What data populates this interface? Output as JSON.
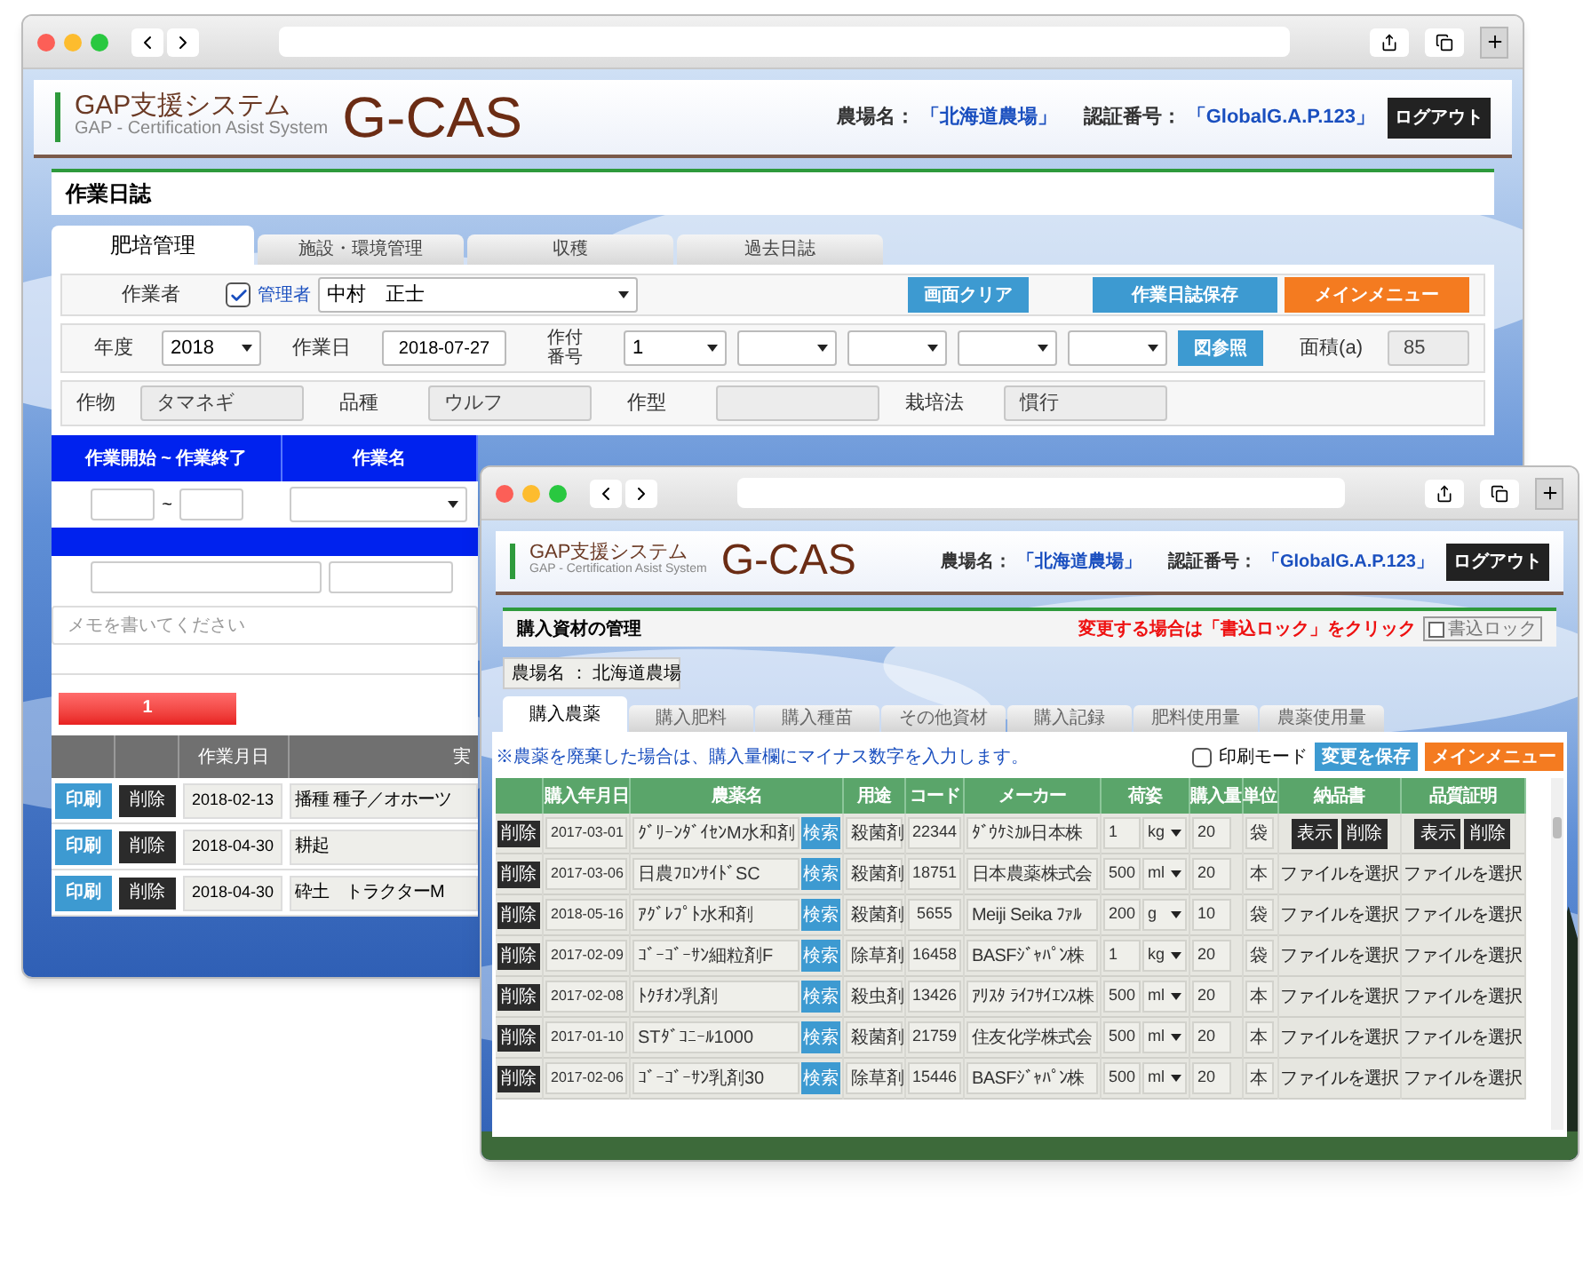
{
  "back_window": {
    "header": {
      "system_name": "GAP支援システム",
      "subtitle": "GAP - Certification Asist System",
      "logo": "G-CAS",
      "farm_label": "農場名：",
      "farm": "「北海道農場」",
      "cert_label": "認証番号：",
      "cert": "「GlobalG.A.P.123」",
      "logout": "ログアウト"
    },
    "page_title": "作業日誌",
    "tabs": [
      {
        "label": "肥培管理",
        "selected": true
      },
      {
        "label": "施設・環境管理",
        "selected": false
      },
      {
        "label": "収穫",
        "selected": false
      },
      {
        "label": "過去日誌",
        "selected": false
      }
    ],
    "worker_row": {
      "label": "作業者",
      "admin": {
        "label": "管理者",
        "checked": true
      },
      "worker": "中村　正士",
      "buttons": [
        {
          "label": "画面クリア",
          "kind": "blue"
        },
        {
          "label": "作業日誌保存",
          "kind": "blue"
        },
        {
          "label": "メインメニュー",
          "kind": "orange"
        }
      ]
    },
    "date_row": {
      "year_label": "年度",
      "year": "2018",
      "date_label": "作業日",
      "date": "2018-07-27",
      "plot_label": "作付番号",
      "plot_number": "1",
      "map_button": "図参照",
      "area_label": "面積(a)",
      "area": "85"
    },
    "crop_row": [
      {
        "label": "作物",
        "value": "タマネギ"
      },
      {
        "label": "品種",
        "value": "ウルフ"
      },
      {
        "label": "作型"
      },
      {
        "label": "栽培法",
        "value": "慣行"
      }
    ],
    "work_table": {
      "columns": [
        "作業開始 ~ 作業終了",
        "作業名"
      ],
      "range_separator": "~"
    },
    "memo": {
      "placeholder": "メモを書いてください"
    },
    "pager": [
      {
        "label": "1",
        "selected": true
      }
    ],
    "history": {
      "columns": [
        "作業月日",
        "実"
      ],
      "rows": [
        {
          "print": "印刷",
          "delete": "削除",
          "date": "2018-02-13",
          "content": "播種 種子／オホーツ"
        },
        {
          "print": "印刷",
          "delete": "削除",
          "date": "2018-04-30",
          "content": "耕起"
        },
        {
          "print": "印刷",
          "delete": "削除",
          "date": "2018-04-30",
          "content": "砕土　トラクターM"
        }
      ]
    }
  },
  "front_window": {
    "header": {
      "system_name": "GAP支援システム",
      "subtitle": "GAP - Certification Asist System",
      "logo": "G-CAS",
      "farm_label": "農場名：",
      "farm": "「北海道農場」",
      "cert_label": "認証番号：",
      "cert": "「GlobalG.A.P.123」",
      "logout": "ログアウト"
    },
    "page_title": "購入資材の管理",
    "lock_notice": "変更する場合は「書込ロック」をクリック",
    "lock": {
      "label": "書込ロック",
      "checked": false
    },
    "farm_field": "農場名 ： 北海道農場",
    "tabs": [
      {
        "label": "購入農薬",
        "selected": true
      },
      {
        "label": "購入肥料",
        "selected": false
      },
      {
        "label": "購入種苗",
        "selected": false
      },
      {
        "label": "その他資材",
        "selected": false
      },
      {
        "label": "購入記録",
        "selected": false
      },
      {
        "label": "肥料使用量",
        "selected": false
      },
      {
        "label": "農薬使用量",
        "selected": false
      }
    ],
    "note": "※農薬を廃棄した場合は、購入量欄にマイナス数字を入力します。",
    "print_mode": {
      "label": "印刷モード",
      "checked": false
    },
    "buttons": [
      {
        "label": "変更を保存",
        "kind": "blue"
      },
      {
        "label": "メインメニュー",
        "kind": "orange"
      }
    ],
    "table": {
      "columns": [
        "購入年月日",
        "農薬名",
        "用途",
        "コード",
        "メーカー",
        "荷姿",
        "購入量",
        "単位",
        "納品書",
        "品質証明"
      ],
      "rows": [
        {
          "delete": "削除",
          "date": "2017-03-01",
          "name": "ｸﾞﾘｰﾝﾀﾞｲｾﾝM水和剤",
          "search": "検索",
          "use": "殺菌剤",
          "code": "22344",
          "maker": "ﾀﾞｳｹﾐｶﾙ日本株",
          "amount": "1",
          "pack_unit": "kg",
          "quantity": "20",
          "unit": "袋",
          "delivery": {
            "kind": "uploaded",
            "buttons": [
              "表示",
              "削除"
            ]
          },
          "certificate": {
            "kind": "uploaded",
            "buttons": [
              "表示",
              "削除"
            ]
          }
        },
        {
          "delete": "削除",
          "date": "2017-03-06",
          "name": "日農ﾌﾛﾝｻｲﾄﾞSC",
          "search": "検索",
          "use": "殺菌剤",
          "code": "18751",
          "maker": "日本農薬株式会",
          "amount": "500",
          "pack_unit": "ml",
          "quantity": "20",
          "unit": "本",
          "delivery": {
            "kind": "file",
            "label": "ファイルを選択"
          },
          "certificate": {
            "kind": "file",
            "label": "ファイルを選択"
          }
        },
        {
          "delete": "削除",
          "date": "2018-05-16",
          "name": "ｱｸﾞﾚﾌﾟﾄ水和剤",
          "search": "検索",
          "use": "殺菌剤",
          "code": "5655",
          "maker": "Meiji Seika ﾌｧﾙ",
          "amount": "200",
          "pack_unit": "g",
          "quantity": "10",
          "unit": "袋",
          "delivery": {
            "kind": "file",
            "label": "ファイルを選択"
          },
          "certificate": {
            "kind": "file",
            "label": "ファイルを選択"
          }
        },
        {
          "delete": "削除",
          "date": "2017-02-09",
          "name": "ｺﾞｰｺﾞｰｻﾝ細粒剤F",
          "search": "検索",
          "use": "除草剤",
          "code": "16458",
          "maker": "BASFｼﾞｬﾊﾟﾝ株",
          "amount": "1",
          "pack_unit": "kg",
          "quantity": "20",
          "unit": "袋",
          "delivery": {
            "kind": "file",
            "label": "ファイルを選択"
          },
          "certificate": {
            "kind": "file",
            "label": "ファイルを選択"
          }
        },
        {
          "delete": "削除",
          "date": "2017-02-08",
          "name": "ﾄｸﾁｵﾝ乳剤",
          "search": "検索",
          "use": "殺虫剤",
          "code": "13426",
          "maker": "ｱﾘｽﾀ ﾗｲﾌｻｲｴﾝｽ株",
          "amount": "500",
          "pack_unit": "ml",
          "quantity": "20",
          "unit": "本",
          "delivery": {
            "kind": "file",
            "label": "ファイルを選択"
          },
          "certificate": {
            "kind": "file",
            "label": "ファイルを選択"
          }
        },
        {
          "delete": "削除",
          "date": "2017-01-10",
          "name": "STﾀﾞｺﾆｰﾙ1000",
          "search": "検索",
          "use": "殺菌剤",
          "code": "21759",
          "maker": "住友化学株式会",
          "amount": "500",
          "pack_unit": "ml",
          "quantity": "20",
          "unit": "本",
          "delivery": {
            "kind": "file",
            "label": "ファイルを選択"
          },
          "certificate": {
            "kind": "file",
            "label": "ファイルを選択"
          }
        },
        {
          "delete": "削除",
          "date": "2017-02-06",
          "name": "ｺﾞｰｺﾞｰｻﾝ乳剤30",
          "search": "検索",
          "use": "除草剤",
          "code": "15446",
          "maker": "BASFｼﾞｬﾊﾟﾝ株",
          "amount": "500",
          "pack_unit": "ml",
          "quantity": "20",
          "unit": "本",
          "delivery": {
            "kind": "file",
            "label": "ファイルを選択"
          },
          "certificate": {
            "kind": "file",
            "label": "ファイルを選択"
          }
        }
      ]
    }
  }
}
